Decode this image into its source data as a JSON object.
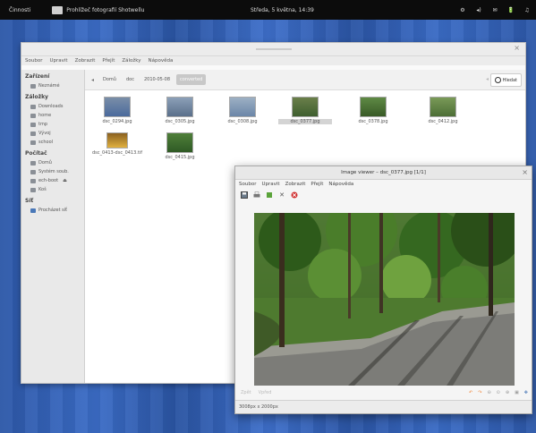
{
  "topbar": {
    "activities": "Činnosti",
    "app_name": "Prohlížeč fotografií Shotwellu",
    "clock": "Středa, 5 května, 14:39",
    "tray": [
      "⚙",
      "◂)",
      "✉",
      "🔋",
      "♫"
    ]
  },
  "fm": {
    "menu": [
      "Soubor",
      "Upravit",
      "Zobrazit",
      "Přejít",
      "Záložky",
      "Nápověda"
    ],
    "sidebar": {
      "groups": [
        {
          "title": "Zařízení",
          "items": [
            "Neznámé"
          ]
        },
        {
          "title": "Záložky",
          "items": [
            "Downloads",
            "home",
            "tmp",
            "Vývoj",
            "school"
          ]
        },
        {
          "title": "Počítač",
          "items": [
            "Domů",
            "Systém soub.",
            "ech-boot",
            "Koš"
          ]
        },
        {
          "title": "Síť",
          "items": [
            "Procházet síť"
          ]
        }
      ]
    },
    "breadcrumbs": [
      "Domů",
      "doc",
      "2010-05-08",
      "converted"
    ],
    "search_label": "Hledat",
    "files": [
      {
        "name": "dsc_0294.jpg",
        "selected": false,
        "colors": [
          "#4a6a9c",
          "#7a8ea8"
        ]
      },
      {
        "name": "dsc_0305.jpg",
        "selected": false,
        "colors": [
          "#5a6f8a",
          "#8ca0b8"
        ]
      },
      {
        "name": "dsc_0308.jpg",
        "selected": false,
        "colors": [
          "#6b86a8",
          "#9db0c4"
        ]
      },
      {
        "name": "dsc_0377.jpg",
        "selected": true,
        "colors": [
          "#3f5f2f",
          "#6a7f4a"
        ]
      },
      {
        "name": "dsc_0378.jpg",
        "selected": false,
        "colors": [
          "#385a26",
          "#5f8a45"
        ]
      },
      {
        "name": "dsc_0412.jpg",
        "selected": false,
        "colors": [
          "#4c6e36",
          "#7a9a58"
        ]
      },
      {
        "name": "dsc_0413-dsc_0413.tif",
        "selected": false,
        "colors": [
          "#e0b040",
          "#8a6020"
        ]
      },
      {
        "name": "dsc_0415.jpg",
        "selected": false,
        "colors": [
          "#2f5a25",
          "#4f7f3a"
        ]
      }
    ]
  },
  "viewer": {
    "title": "Image viewer – dsc_0377.jpg [1/1]",
    "menu": [
      "Soubor",
      "Upravit",
      "Zobrazit",
      "Přejít",
      "Nápověda"
    ],
    "tools": [
      "save-icon",
      "print-icon",
      "edit-icon",
      "close-icon",
      "delete-icon"
    ],
    "bottom_left": [
      "Zpět",
      "Vpřed"
    ],
    "status": "3008px x 2000px"
  },
  "colors": {
    "accent": "#f08030",
    "panel": "#0c0c0c"
  }
}
